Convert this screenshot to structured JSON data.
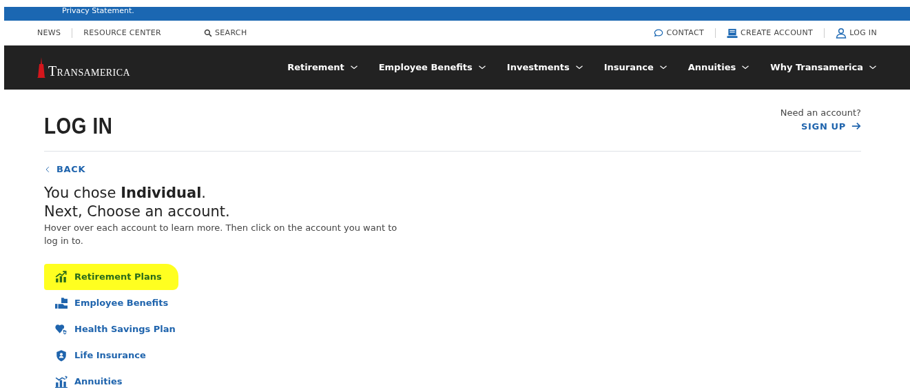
{
  "banner": {
    "text": "Privacy Statement."
  },
  "utility_nav": {
    "left": [
      {
        "label": "NEWS"
      },
      {
        "label": "RESOURCE CENTER"
      },
      {
        "label": "SEARCH"
      }
    ],
    "right": [
      {
        "label": "CONTACT"
      },
      {
        "label": "CREATE ACCOUNT"
      },
      {
        "label": "LOG IN"
      }
    ]
  },
  "logo": {
    "text": "Transamerica"
  },
  "main_nav": [
    {
      "label": "Retirement"
    },
    {
      "label": "Employee Benefits"
    },
    {
      "label": "Investments"
    },
    {
      "label": "Insurance"
    },
    {
      "label": "Annuities"
    },
    {
      "label": "Why Transamerica"
    }
  ],
  "page_title": "LOG IN",
  "signup": {
    "prompt": "Need an account?",
    "link": "SIGN UP"
  },
  "back_link": "BACK",
  "heading_1": "You chose **Individual**.",
  "heading_2": "Next, Choose an account.",
  "instructions": "Hover over each account to learn more. Then click on the account you want to log in to.",
  "accounts": [
    {
      "label": "Retirement Plans",
      "highlighted": true
    },
    {
      "label": "Employee Benefits",
      "highlighted": false
    },
    {
      "label": "Health Savings Plan",
      "highlighted": false
    },
    {
      "label": "Life Insurance",
      "highlighted": false
    },
    {
      "label": "Annuities",
      "highlighted": false
    }
  ]
}
